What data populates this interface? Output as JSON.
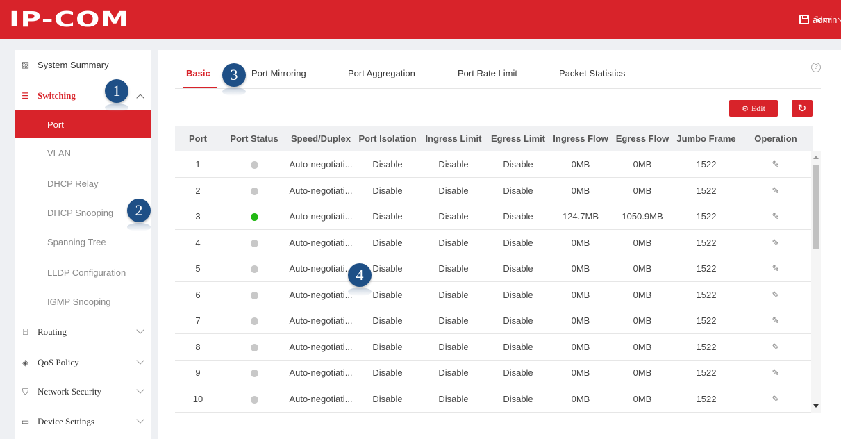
{
  "header": {
    "logo": "IP-COM",
    "save_label": "Save",
    "user_label": "admin"
  },
  "sidebar": {
    "groups": [
      {
        "label": "System Summary",
        "icon": "chart-icon"
      },
      {
        "label": "Switching",
        "icon": "sliders-icon",
        "expanded": true
      },
      {
        "label": "Routing",
        "icon": "router-icon"
      },
      {
        "label": "QoS Policy",
        "icon": "layers-icon"
      },
      {
        "label": "Network Security",
        "icon": "shield-icon"
      },
      {
        "label": "Device Settings",
        "icon": "device-icon"
      }
    ],
    "switching_items": [
      "Port",
      "VLAN",
      "DHCP Relay",
      "DHCP Snooping",
      "Spanning Tree",
      "LLDP Configuration",
      "IGMP Snooping"
    ],
    "active_item": "Port"
  },
  "tabs": [
    "Basic",
    "Port Mirroring",
    "Port Aggregation",
    "Port Rate Limit",
    "Packet Statistics"
  ],
  "active_tab": "Basic",
  "toolbar": {
    "edit_label": "Edit"
  },
  "table": {
    "headers": [
      "Port",
      "Port Status",
      "Speed/Duplex",
      "Port Isolation",
      "Ingress Limit",
      "Egress Limit",
      "Ingress Flow",
      "Egress Flow",
      "Jumbo Frame",
      "Operation"
    ],
    "rows": [
      {
        "port": "1",
        "status": "down",
        "speed": "Auto-negotiati...",
        "isolation": "Disable",
        "ingress_limit": "Disable",
        "egress_limit": "Disable",
        "ingress_flow": "0MB",
        "egress_flow": "0MB",
        "jumbo": "1522"
      },
      {
        "port": "2",
        "status": "down",
        "speed": "Auto-negotiati...",
        "isolation": "Disable",
        "ingress_limit": "Disable",
        "egress_limit": "Disable",
        "ingress_flow": "0MB",
        "egress_flow": "0MB",
        "jumbo": "1522"
      },
      {
        "port": "3",
        "status": "up",
        "speed": "Auto-negotiati...",
        "isolation": "Disable",
        "ingress_limit": "Disable",
        "egress_limit": "Disable",
        "ingress_flow": "124.7MB",
        "egress_flow": "1050.9MB",
        "jumbo": "1522"
      },
      {
        "port": "4",
        "status": "down",
        "speed": "Auto-negotiati...",
        "isolation": "Disable",
        "ingress_limit": "Disable",
        "egress_limit": "Disable",
        "ingress_flow": "0MB",
        "egress_flow": "0MB",
        "jumbo": "1522"
      },
      {
        "port": "5",
        "status": "down",
        "speed": "Auto-negotiati...",
        "isolation": "Disable",
        "ingress_limit": "Disable",
        "egress_limit": "Disable",
        "ingress_flow": "0MB",
        "egress_flow": "0MB",
        "jumbo": "1522"
      },
      {
        "port": "6",
        "status": "down",
        "speed": "Auto-negotiati...",
        "isolation": "Disable",
        "ingress_limit": "Disable",
        "egress_limit": "Disable",
        "ingress_flow": "0MB",
        "egress_flow": "0MB",
        "jumbo": "1522"
      },
      {
        "port": "7",
        "status": "down",
        "speed": "Auto-negotiati...",
        "isolation": "Disable",
        "ingress_limit": "Disable",
        "egress_limit": "Disable",
        "ingress_flow": "0MB",
        "egress_flow": "0MB",
        "jumbo": "1522"
      },
      {
        "port": "8",
        "status": "down",
        "speed": "Auto-negotiati...",
        "isolation": "Disable",
        "ingress_limit": "Disable",
        "egress_limit": "Disable",
        "ingress_flow": "0MB",
        "egress_flow": "0MB",
        "jumbo": "1522"
      },
      {
        "port": "9",
        "status": "down",
        "speed": "Auto-negotiati...",
        "isolation": "Disable",
        "ingress_limit": "Disable",
        "egress_limit": "Disable",
        "ingress_flow": "0MB",
        "egress_flow": "0MB",
        "jumbo": "1522"
      },
      {
        "port": "10",
        "status": "down",
        "speed": "Auto-negotiati...",
        "isolation": "Disable",
        "ingress_limit": "Disable",
        "egress_limit": "Disable",
        "ingress_flow": "0MB",
        "egress_flow": "0MB",
        "jumbo": "1522"
      }
    ]
  },
  "callouts": [
    "1",
    "2",
    "3",
    "4"
  ],
  "colors": {
    "brand": "#d8232a",
    "status_up": "#22b814",
    "status_down": "#c8c8c8",
    "callout": "#1e4f86"
  }
}
